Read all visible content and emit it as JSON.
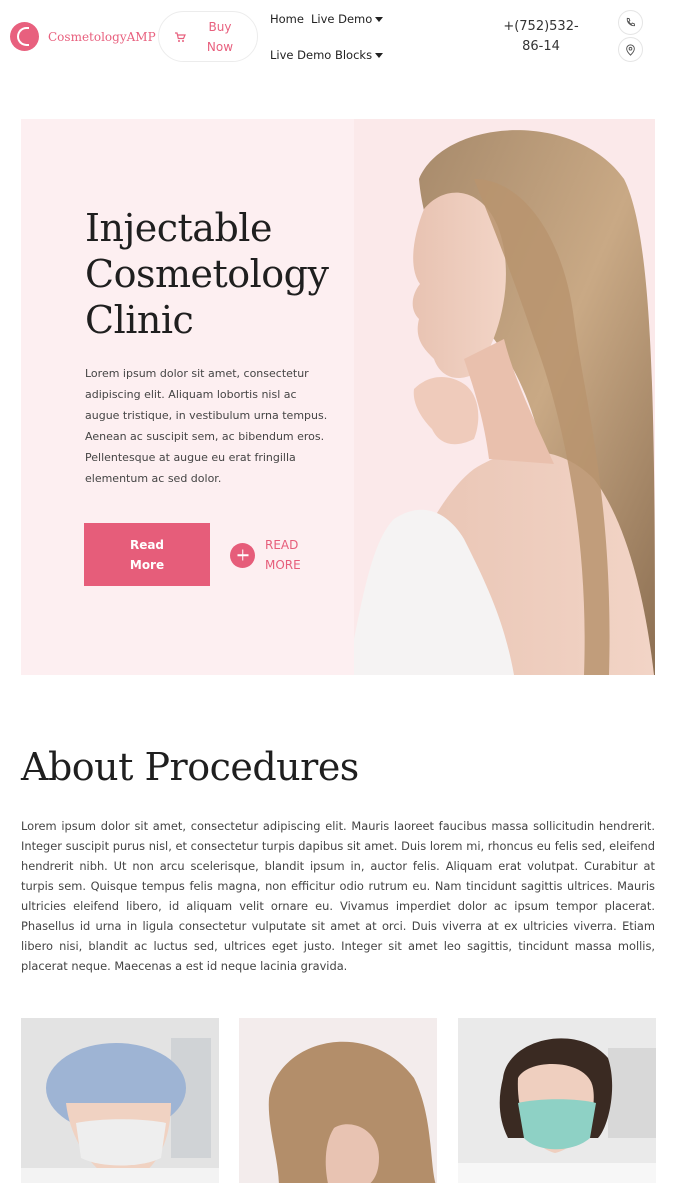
{
  "header": {
    "logo_text": "CosmetologyAMP",
    "buy_now_label": "Buy Now",
    "nav": [
      {
        "label": "Home"
      },
      {
        "label": "Live Demo"
      },
      {
        "label": "Live Demo Blocks"
      }
    ],
    "phone": "+(752)532-86-14",
    "icons": [
      "phone-icon",
      "location-pin-icon"
    ]
  },
  "hero": {
    "title": "Injectable Cosmetology Clinic",
    "text": "Lorem ipsum dolor sit amet, consectetur adipiscing elit. Aliquam lobortis nisl ac augue tristique, in vestibulum urna tempus. Aenean ac suscipit sem, ac bibendum eros. Pellentesque at augue eu erat fringilla elementum ac sed dolor.",
    "primary_button": "Read More",
    "secondary_button": "READ MORE",
    "background": "#fdeff1"
  },
  "about": {
    "title": "About Procedures",
    "text": "Lorem ipsum dolor sit amet, consectetur adipiscing elit. Mauris laoreet faucibus massa sollicitudin hendrerit. Integer suscipit purus nisl, et consectetur turpis dapibus sit amet. Duis lorem mi, rhoncus eu felis sed, eleifend hendrerit nibh. Ut non arcu scelerisque, blandit ipsum in, auctor felis. Aliquam erat volutpat. Curabitur at turpis sem. Quisque tempus felis magna, non efficitur odio rutrum eu. Nam tincidunt sagittis ultrices. Mauris ultricies eleifend libero, id aliquam velit ornare eu. Vivamus imperdiet dolor ac ipsum tempor placerat. Phasellus id urna in ligula consectetur vulputate sit amet at orci. Duis viverra at ex ultricies viverra. Etiam libero nisi, blandit ac luctus sed, ultrices eget justo. Integer sit amet leo sagittis, tincidunt massa mollis, placerat neque. Maecenas a est id neque lacinia gravida."
  },
  "colors": {
    "accent": "#e65d7a",
    "hero_bg": "#fdeff1",
    "text_dark": "#1f1f1f"
  }
}
